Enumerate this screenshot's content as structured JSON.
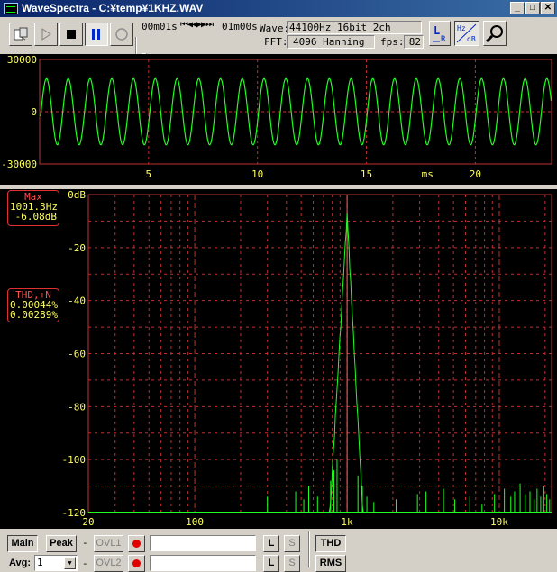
{
  "window": {
    "title": "WaveSpectra - C:¥temp¥1KHZ.WAV",
    "minimize_glyph": "_",
    "maximize_glyph": "□",
    "close_glyph": "✕"
  },
  "toolbar": {
    "position_label": "00m01s",
    "length_label": "01m00s",
    "nav_glyphs": "⏮◀◀▶▶⏭",
    "wave_label": "Wave:",
    "wave_value": "44100Hz 16bit 2ch",
    "fft_label": "FFT:",
    "fft_value": "4096 Hanning",
    "fps_label": "fps:",
    "fps_value": "82",
    "lr_button": "L R",
    "hz_db_button_top": "Hz",
    "hz_db_button_bottom": "dB",
    "play_position_fraction": 0.02
  },
  "waveform": {
    "y_ticks": [
      "30000",
      "0",
      "-30000"
    ],
    "x_ticks": [
      "5",
      "10",
      "15",
      "20"
    ],
    "x_unit": "ms",
    "amplitude": 19000,
    "frequency_hz": 1001.3,
    "x_range_ms": [
      0,
      23.5
    ],
    "y_range": [
      -30000,
      30000
    ],
    "grid_color": "#c03030",
    "trace_color": "#20ff20"
  },
  "spectrum": {
    "y_ticks": [
      "0dB",
      "-20",
      "-40",
      "-60",
      "-80",
      "-100",
      "-120"
    ],
    "x_ticks": [
      "20",
      "100",
      "1k",
      "10k"
    ],
    "x_range_hz": [
      20,
      22050
    ],
    "y_range_db": [
      -120,
      0
    ],
    "peak_freq_hz": 1001.3,
    "peak_db": -6.08,
    "max_box": {
      "title": "Max",
      "freq": "1001.3Hz",
      "level": "-6.08dB"
    },
    "thd_box": {
      "title": "THD,+N",
      "thd": "0.00044%",
      "thdn": "0.00289%"
    },
    "grid_color": "#c03030",
    "trace_color": "#20ff20",
    "cursor_color": "#ff6060"
  },
  "bottom": {
    "main_button": "Main",
    "peak_button": "Peak",
    "dash1": "-",
    "ovl1_button": "OVL1",
    "l_button": "L",
    "s_button": "S",
    "thd_button": "THD",
    "rms_button": "RMS",
    "avg_label": "Avg:",
    "avg_value": "1",
    "dash2": "-",
    "ovl2_button": "OVL2",
    "l2_button": "L",
    "s2_button": "S"
  }
}
